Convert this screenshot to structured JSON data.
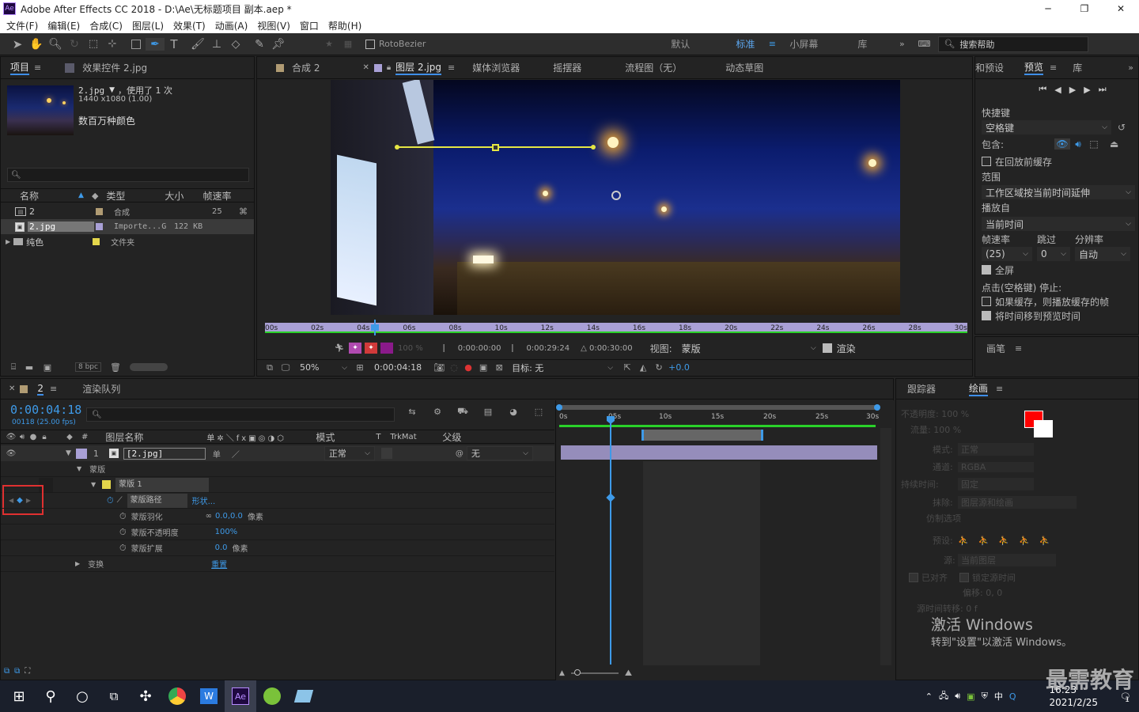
{
  "titlebar": {
    "app_icon": "Ae",
    "title": "Adobe After Effects CC 2018 - D:\\Ae\\无标题项目 副本.aep *",
    "min": "─",
    "max": "❐",
    "close": "✕"
  },
  "menu": [
    "文件(F)",
    "编辑(E)",
    "合成(C)",
    "图层(L)",
    "效果(T)",
    "动画(A)",
    "视图(V)",
    "窗口",
    "帮助(H)"
  ],
  "toolbar": {
    "rotobezier": "RotoBezier",
    "workspaces": [
      "默认",
      "标准",
      "小屏幕",
      "库"
    ],
    "active_workspace": "标准",
    "search_placeholder": "搜索帮助"
  },
  "project": {
    "tabs": [
      "项目",
      "效果控件 2.jpg"
    ],
    "item_name": "2.jpg",
    "item_usage": "，使用了 1 次",
    "item_size": "1440 x1080 (1.00)",
    "item_colors": "数百万种颜色",
    "search_placeholder": "",
    "cols": [
      "名称",
      "类型",
      "大小",
      "帧速率"
    ],
    "rows": [
      {
        "name": "2",
        "type": "合成",
        "size": "",
        "fps": "25",
        "color": "#b09b73"
      },
      {
        "name": "2.jpg",
        "type": "Importe...G",
        "size": "122 KB",
        "fps": "",
        "color": "#a9a0d6"
      },
      {
        "name": "纯色",
        "type": "文件夹",
        "size": "",
        "fps": "",
        "color": "#e4d64b"
      }
    ],
    "bpc": "8 bpc"
  },
  "viewer": {
    "tabs": [
      "合成 2",
      "图层 2.jpg",
      "媒体浏览器",
      "摇摆器",
      "流程图（无）",
      "动态草图"
    ],
    "ruler": [
      "00s",
      "02s",
      "04s",
      "06s",
      "08s",
      "10s",
      "12s",
      "14s",
      "16s",
      "18s",
      "20s",
      "22s",
      "24s",
      "26s",
      "28s",
      "30s"
    ],
    "opacity": "100 %",
    "tc_start": "0:00:00:00",
    "tc_end": "0:00:29:24",
    "tc_dur": "△ 0:00:30:00",
    "view_label": "视图:",
    "view_value": "蒙版",
    "render_label": "渲染",
    "zoom": "50%",
    "current_tc": "0:00:04:18",
    "target": "目标: 无",
    "exposure": "+0.0"
  },
  "preview": {
    "tabs": [
      "和预设",
      "预览",
      "库"
    ],
    "shortcut_label": "快捷键",
    "shortcut_value": "空格键",
    "include_label": "包含:",
    "cache_before": "在回放前缓存",
    "range_label": "范围",
    "range_value": "工作区域按当前时间延伸",
    "play_from_label": "播放自",
    "play_from_value": "当前时间",
    "fps_label": "帧速率",
    "skip_label": "跳过",
    "res_label": "分辨率",
    "fps_value": "(25)",
    "skip_value": "0",
    "res_value": "自动",
    "fullscreen": "全屏",
    "stop_label": "点击(空格键) 停止:",
    "stop_opt1": "如果缓存，则播放缓存的帧",
    "stop_opt2": "将时间移到预览时间",
    "brush_tab": "画笔"
  },
  "timeline": {
    "tab_render": "渲染队列",
    "comp": "2",
    "timecode": "0:00:04:18",
    "frames": "00118 (25.00 fps)",
    "cols": [
      "图层名称",
      "模式",
      "T",
      "TrkMat",
      "父级"
    ],
    "layer_num": "1",
    "layer_name": "[2.jpg]",
    "layer_mode": "正常",
    "layer_parent": "无",
    "masks_label": "蒙版",
    "mask_name": "蒙版 1",
    "props": [
      {
        "name": "蒙版路径",
        "value": "形状..."
      },
      {
        "name": "蒙版羽化",
        "value": "0.0,0.0",
        "unit": "像素"
      },
      {
        "name": "蒙版不透明度",
        "value": "100%"
      },
      {
        "name": "蒙版扩展",
        "value": "0.0",
        "unit": "像素"
      }
    ],
    "transform": "变换",
    "transform_value": "重置",
    "ruler": [
      "0s",
      "05s",
      "10s",
      "15s",
      "20s",
      "25s",
      "30s"
    ]
  },
  "paint": {
    "tabs": [
      "跟踪器",
      "绘画"
    ],
    "opacity": "不透明度: 100 %",
    "flow": "流量: 100 %",
    "mode_label": "模式:",
    "mode_value": "正常",
    "channel_label": "通道:",
    "channel_value": "RGBA",
    "duration_label": "持续时间:",
    "duration_value": "固定",
    "erase_label": "抹除:",
    "erase_value": "图层源和绘画",
    "clone_label": "仿制选项",
    "preset_label": "预设:",
    "source_label": "源:",
    "source_value": "当前图层",
    "aligned": "已对齐",
    "lock_time": "锁定源时间",
    "offset": "偏移: 0, 0",
    "time_shift": "源时间转移: 0 f",
    "watermark1": "激活 Windows",
    "watermark2": "转到\"设置\"以激活 Windows。"
  },
  "taskbar": {
    "time": "16:23",
    "date": "2021/2/25",
    "ime": "中",
    "brand": "最需教育",
    "notif": "1"
  }
}
